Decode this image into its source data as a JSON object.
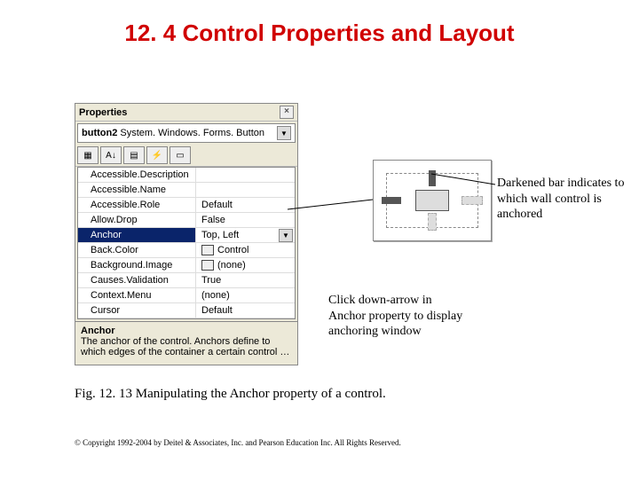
{
  "heading": "12. 4  Control Properties and Layout",
  "panel": {
    "title": "Properties",
    "object_bold": "button2",
    "object_rest": "  System. Windows. Forms. Button",
    "rows": [
      {
        "name": "Accessible.Description",
        "value": ""
      },
      {
        "name": "Accessible.Name",
        "value": ""
      },
      {
        "name": "Accessible.Role",
        "value": "Default"
      },
      {
        "name": "Allow.Drop",
        "value": "False"
      },
      {
        "name": "Anchor",
        "value": "Top, Left",
        "selected": true,
        "dropdown": true
      },
      {
        "name": "Back.Color",
        "value": "Control",
        "swatch": true
      },
      {
        "name": "Background.Image",
        "value": "(none)",
        "swatch": true
      },
      {
        "name": "Causes.Validation",
        "value": "True"
      },
      {
        "name": "Context.Menu",
        "value": "(none)"
      },
      {
        "name": "Cursor",
        "value": "Default"
      }
    ],
    "desc_name": "Anchor",
    "desc_text": "The anchor of the control. Anchors define to which edges of the container a certain control …"
  },
  "callout1": "Darkened bar indicates to which wall control is anchored",
  "callout2": "Click down-arrow in Anchor property to display anchoring window",
  "caption": "Fig. 12. 13 Manipulating the Anchor property of a control.",
  "copyright": "© Copyright 1992-2004 by Deitel & Associates, Inc. and Pearson Education Inc. All Rights Reserved."
}
